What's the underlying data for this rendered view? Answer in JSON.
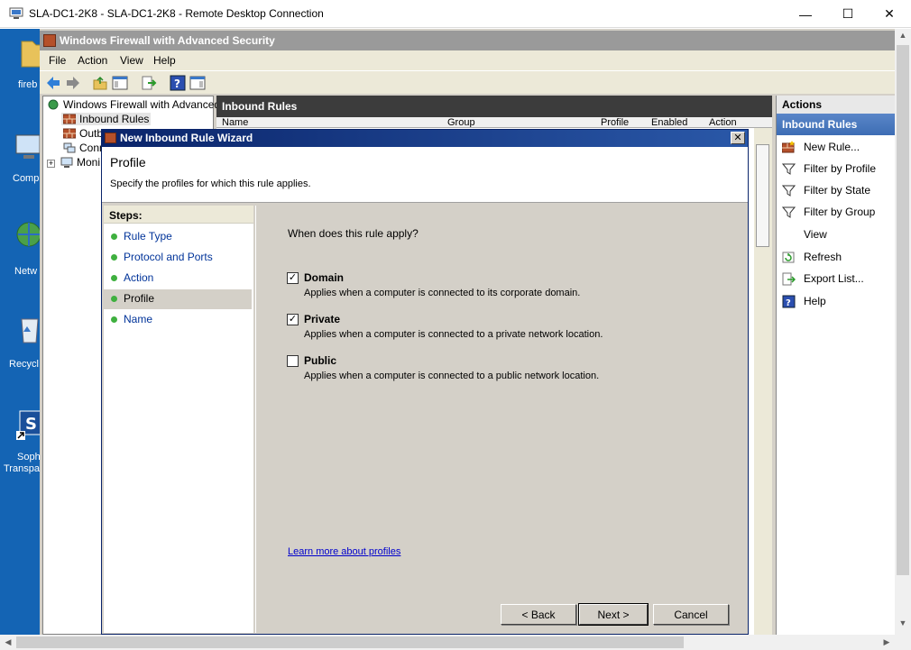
{
  "rdp": {
    "title": "SLA-DC1-2K8 - SLA-DC1-2K8 - Remote Desktop Connection",
    "minimize": "—",
    "maximize": "☐",
    "close": "✕"
  },
  "desktop_icons": [
    {
      "label": "fireb"
    },
    {
      "label": "Comp"
    },
    {
      "label": "Netw"
    },
    {
      "label": "Recycl"
    },
    {
      "label": "Soph"
    },
    {
      "label": "Transpa"
    }
  ],
  "mmc": {
    "title": "Windows Firewall with Advanced Security",
    "menu": [
      "File",
      "Action",
      "View",
      "Help"
    ],
    "tree": {
      "root": "Windows Firewall with Advanced S",
      "items": [
        "Inbound Rules",
        "Outb",
        "Conn",
        "Moni"
      ]
    },
    "center": {
      "header": "Inbound Rules",
      "columns": [
        "Name",
        "Group",
        "Profile",
        "Enabled",
        "Action"
      ]
    },
    "actions": {
      "header": "Actions",
      "section": "Inbound Rules",
      "items": [
        {
          "label": "New Rule...",
          "icon": "new-rule-icon"
        },
        {
          "label": "Filter by Profile",
          "icon": "filter-icon"
        },
        {
          "label": "Filter by State",
          "icon": "filter-icon"
        },
        {
          "label": "Filter by Group",
          "icon": "filter-icon"
        },
        {
          "label": "View",
          "icon": "none"
        },
        {
          "label": "Refresh",
          "icon": "refresh-icon"
        },
        {
          "label": "Export List...",
          "icon": "export-icon"
        },
        {
          "label": "Help",
          "icon": "help-icon"
        }
      ]
    }
  },
  "wizard": {
    "title": "New Inbound Rule Wizard",
    "close": "✕",
    "page_title": "Profile",
    "page_subtitle": "Specify the profiles for which this rule applies.",
    "steps_header": "Steps:",
    "steps": [
      "Rule Type",
      "Protocol and Ports",
      "Action",
      "Profile",
      "Name"
    ],
    "selected_step": "Profile",
    "question": "When does this rule apply?",
    "options": [
      {
        "label": "Domain",
        "checked": true,
        "desc": "Applies when a computer is connected to its corporate domain."
      },
      {
        "label": "Private",
        "checked": true,
        "desc": "Applies when a computer is connected to a private network location."
      },
      {
        "label": "Public",
        "checked": false,
        "desc": "Applies when a computer is connected to a public network location."
      }
    ],
    "learn_more": "Learn more about profiles",
    "buttons": {
      "back": "< Back",
      "next": "Next >",
      "cancel": "Cancel"
    }
  },
  "colors": {
    "desktop": "#1464b4",
    "wizard_title": "#0a246a",
    "actions_section": "#4a7abf",
    "link": "#0000cc"
  }
}
